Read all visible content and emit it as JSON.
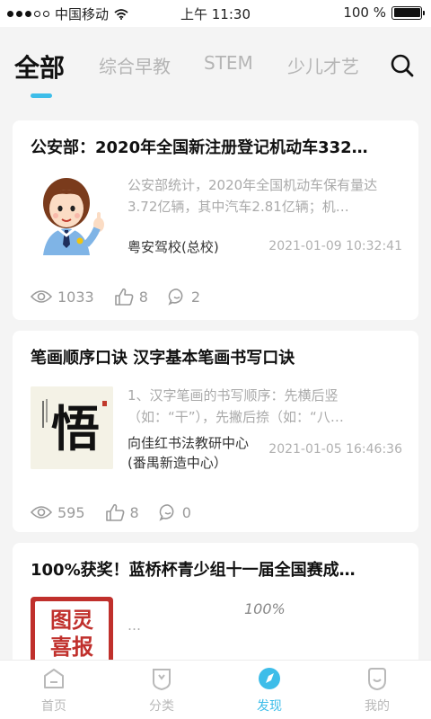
{
  "status_bar": {
    "carrier": "中国移动",
    "time": "上午 11:30",
    "battery": "100 %"
  },
  "top_tabs": [
    {
      "label": "全部",
      "active": true
    },
    {
      "label": "综合早教",
      "active": false
    },
    {
      "label": "STEM",
      "active": false
    },
    {
      "label": "少儿才艺",
      "active": false
    }
  ],
  "articles": [
    {
      "title": "公安部：2020年全国新注册登记机动车332…",
      "summary": "公安部统计，2020年全国机动车保有量达3.72亿辆，其中汽车2.81亿辆；机…",
      "author": "粤安驾校(总校)",
      "date": "2021-01-09 10:32:41",
      "views": "1033",
      "likes": "8",
      "comments": "2",
      "thumb": "police-cartoon"
    },
    {
      "title": "笔画顺序口诀 汉字基本笔画书写口诀",
      "summary": "1、汉字笔画的书写顺序：先横后竖（如：“干”），先撇后捺（如：“八…",
      "author": "向佳红书法教研中心(番禺新造中心）",
      "date": "2021-01-05 16:46:36",
      "views": "595",
      "likes": "8",
      "comments": "0",
      "thumb": "calligraphy",
      "thumb_char": "悟"
    },
    {
      "title": "100%获奖！蓝桥杯青少组十一届全国赛成…",
      "summary": "…",
      "overlay_text": "100%",
      "thumb": "turing-poster",
      "thumb_text_1": "图灵",
      "thumb_text_2": "喜报"
    }
  ],
  "bottom_nav": [
    {
      "label": "首页",
      "icon": "home-icon",
      "active": false
    },
    {
      "label": "分类",
      "icon": "category-icon",
      "active": false
    },
    {
      "label": "发现",
      "icon": "discover-icon",
      "active": true
    },
    {
      "label": "我的",
      "icon": "profile-icon",
      "active": false
    }
  ],
  "colors": {
    "accent": "#3dbde9",
    "background": "#f4f4f4",
    "card": "#ffffff",
    "muted_text": "#aaaaaa"
  }
}
